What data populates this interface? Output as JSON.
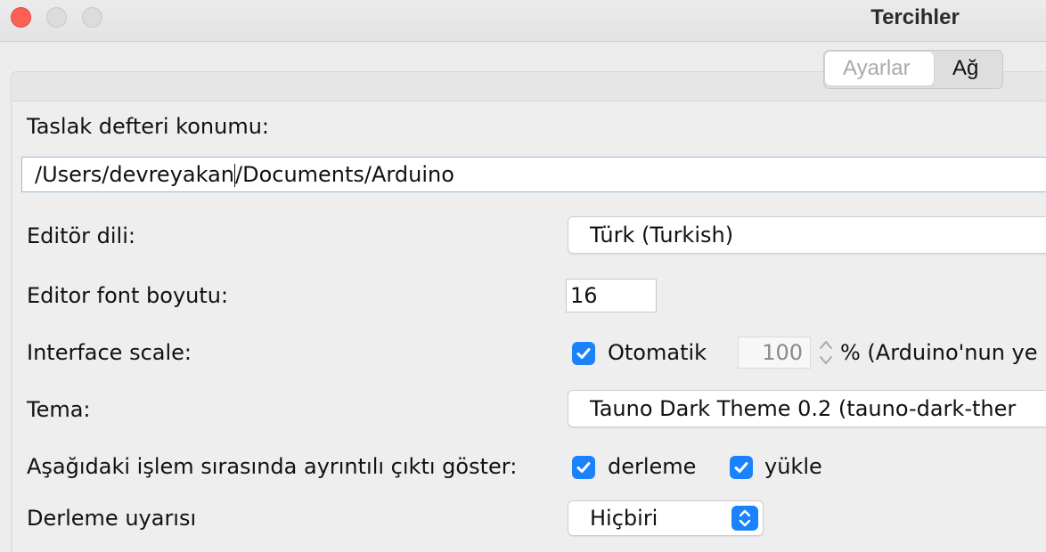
{
  "window": {
    "title": "Tercihler"
  },
  "tabs": [
    {
      "label": "Ayarlar",
      "active": true
    },
    {
      "label": "Ağ",
      "active": false
    }
  ],
  "sketchbook": {
    "label": "Taslak defteri konumu:",
    "path_before_caret": "/Users/devreyakan",
    "path_after_caret": "/Documents/Arduino"
  },
  "editor_language": {
    "label": "Editör dili:",
    "value": "Türk (Turkish)"
  },
  "editor_font_size": {
    "label": "Editor font boyutu:",
    "value": "16"
  },
  "interface_scale": {
    "label": "Interface scale:",
    "auto_label": "Otomatik",
    "auto_checked": true,
    "scale_value": "100",
    "suffix": "% (Arduino'nun ye"
  },
  "theme": {
    "label": "Tema:",
    "value": "Tauno Dark Theme 0.2 (tauno-dark-ther"
  },
  "verbose_output": {
    "label": "Aşağıdaki işlem sırasında ayrıntılı çıktı göster:",
    "compile_label": "derleme",
    "compile_checked": true,
    "upload_label": "yükle",
    "upload_checked": true
  },
  "compiler_warnings": {
    "label": "Derleme uyarısı",
    "value": "Hiçbiri"
  },
  "colors": {
    "accent": "#1a82fb",
    "close_light": "#fe5f57"
  },
  "icons": {
    "checkbox": "checkmark-icon",
    "popup": "chevron-updown-icon",
    "stepper": "stepper-arrows-icon"
  }
}
